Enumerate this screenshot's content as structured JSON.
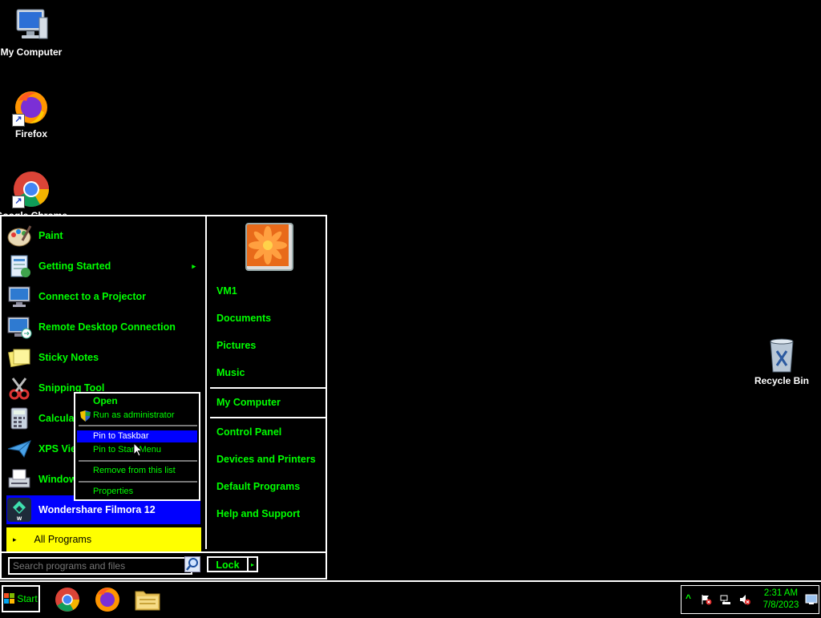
{
  "desktop": {
    "icons": [
      {
        "label": "My Computer",
        "icon": "computer-icon"
      },
      {
        "label": "Firefox",
        "icon": "firefox-icon"
      },
      {
        "label": "Google Chrome",
        "icon": "chrome-icon"
      },
      {
        "label": "Recycle Bin",
        "icon": "recycle-bin-icon"
      }
    ]
  },
  "start_menu": {
    "programs": [
      {
        "label": "Paint",
        "icon": "paint-icon"
      },
      {
        "label": "Getting Started",
        "icon": "getting-started-icon",
        "submenu_arrow": "▸"
      },
      {
        "label": "Connect to a Projector",
        "icon": "projector-icon"
      },
      {
        "label": "Remote Desktop Connection",
        "icon": "remote-desktop-icon"
      },
      {
        "label": "Sticky Notes",
        "icon": "sticky-notes-icon"
      },
      {
        "label": "Snipping Tool",
        "icon": "snipping-tool-icon"
      },
      {
        "label": "Calculator",
        "icon": "calculator-icon"
      },
      {
        "label": "XPS Viewer",
        "icon": "xps-viewer-icon"
      },
      {
        "label": "Windows Fax and Scan",
        "icon": "fax-scan-icon"
      },
      {
        "label": "Wondershare Filmora 12",
        "icon": "filmora-icon",
        "selected": true
      }
    ],
    "all_programs": {
      "label": "All Programs",
      "arrow": "▸"
    },
    "search": {
      "placeholder": "Search programs and files"
    },
    "lock_button": {
      "label": "Lock",
      "arrow": "▸"
    },
    "right_links": [
      {
        "label": "VM1"
      },
      {
        "label": "Documents"
      },
      {
        "label": "Pictures"
      },
      {
        "label": "Music"
      },
      {
        "label": "My Computer"
      },
      {
        "label": "Control Panel"
      },
      {
        "label": "Devices and Printers"
      },
      {
        "label": "Default Programs"
      },
      {
        "label": "Help and Support"
      }
    ],
    "user_picture": "flower-avatar-icon"
  },
  "context_menu": {
    "items": [
      {
        "label": "Open",
        "bold": true
      },
      {
        "label": "Run as administrator",
        "icon": "uac-shield-icon"
      },
      {
        "label": "Pin to Taskbar",
        "highlighted": true
      },
      {
        "label": "Pin to Start Menu"
      },
      {
        "label": "Remove from this list"
      },
      {
        "label": "Properties"
      }
    ]
  },
  "taskbar": {
    "start_label": "Start",
    "pinned": [
      "chrome-icon",
      "firefox-icon",
      "file-explorer-icon"
    ],
    "tray": {
      "show_hidden": "^",
      "time": "2:31 AM",
      "date": "7/8/2023"
    }
  },
  "colors": {
    "text": "#00ff00",
    "selection": "#0000ff",
    "all_programs_bg": "#ffff00",
    "border": "#ffffff",
    "background": "#000000"
  }
}
